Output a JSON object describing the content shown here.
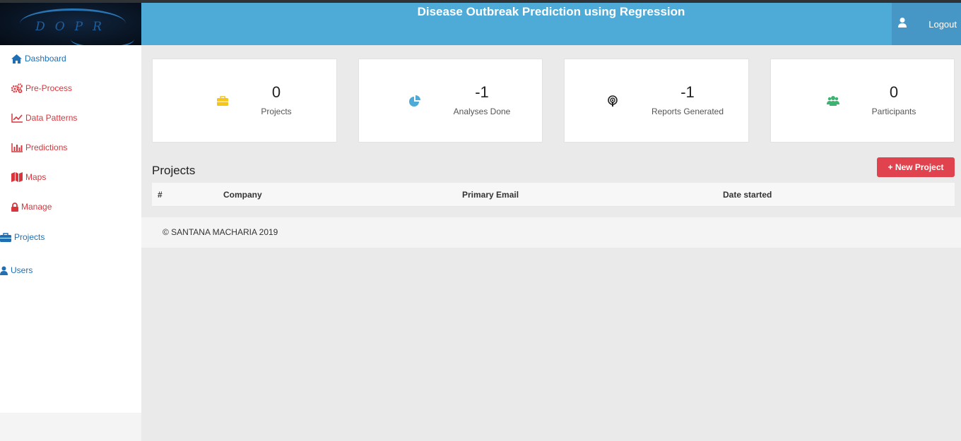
{
  "logo": {
    "text": "DOPR"
  },
  "header": {
    "title": "Disease Outbreak Prediction using Regression",
    "logout_label": "Logout"
  },
  "sidebar": {
    "items": [
      {
        "label": "Dashboard",
        "icon": "home-icon",
        "color": "#1f6fb5"
      },
      {
        "label": "Pre-Process",
        "icon": "gears-icon",
        "color": "#d9353c"
      },
      {
        "label": "Data Patterns",
        "icon": "line-chart-icon",
        "color": "#d9353c"
      },
      {
        "label": "Predictions",
        "icon": "bar-chart-icon",
        "color": "#d9353c"
      },
      {
        "label": "Maps",
        "icon": "map-icon",
        "color": "#d9353c"
      },
      {
        "label": "Manage",
        "icon": "lock-icon",
        "color": "#d9353c"
      },
      {
        "label": "Projects",
        "icon": "briefcase-icon",
        "color": "#1f6fb5"
      },
      {
        "label": "Users",
        "icon": "user-icon",
        "color": "#1f6fb5"
      }
    ]
  },
  "stats": [
    {
      "value": "0",
      "label": "Projects",
      "icon": "briefcase-icon",
      "color": "#f5c518"
    },
    {
      "value": "-1",
      "label": "Analyses Done",
      "icon": "pie-chart-icon",
      "color": "#4eabd8"
    },
    {
      "value": "-1",
      "label": "Reports Generated",
      "icon": "podcast-icon",
      "color": "#222222"
    },
    {
      "value": "0",
      "label": "Participants",
      "icon": "users-icon",
      "color": "#3cb371"
    }
  ],
  "projects": {
    "title": "Projects",
    "new_button": "+ New Project",
    "columns": [
      "#",
      "Company",
      "Primary Email",
      "Date started"
    ]
  },
  "footer": {
    "copyright": "© SANTANA MACHARIA 2019"
  },
  "colors": {
    "header": "#4eabd8",
    "accent_red": "#e0434d",
    "nav_blue": "#1f6fb5",
    "nav_red": "#d9353c"
  }
}
